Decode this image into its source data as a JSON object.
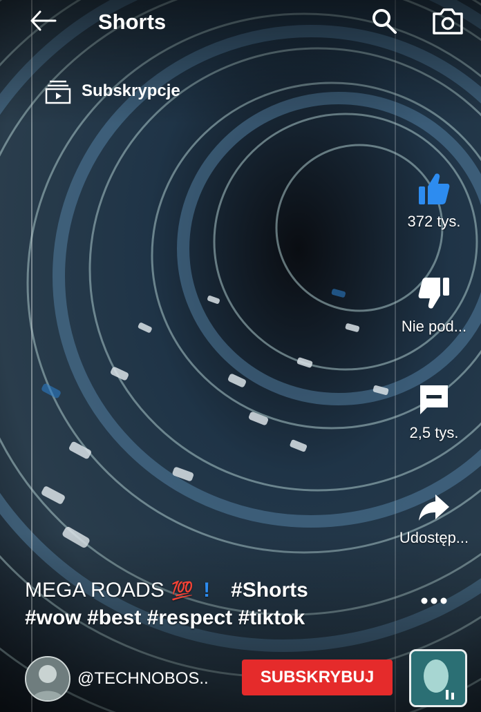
{
  "header": {
    "title": "Shorts"
  },
  "subscriptions": {
    "label": "Subskrypcje"
  },
  "actions": {
    "like_count": "372 tys.",
    "dislike_label": "Nie pod...",
    "comments_count": "2,5 tys.",
    "share_label": "Udostęp..."
  },
  "caption": {
    "title": "MEGA ROADS",
    "emoji": "💯",
    "bang": "!",
    "tag": "#Shorts",
    "hashtags": "#wow #best #respect #tiktok"
  },
  "channel": {
    "handle": "@TECHNOBOS..",
    "subscribe_label": "SUBSKRYBUJ"
  },
  "colors": {
    "like_accent": "#2d8cf0",
    "subscribe": "#e52b2b"
  }
}
